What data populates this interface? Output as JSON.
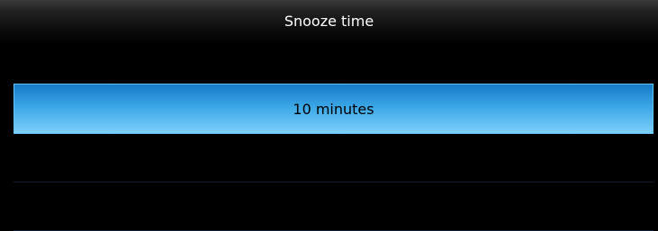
{
  "dialog": {
    "title": "Snooze time"
  },
  "options": [
    {
      "label": "10 minutes",
      "selected": true
    }
  ],
  "colors": {
    "background": "#000000",
    "title_text": "#ffffff",
    "selection_top": "#1579c4",
    "selection_bottom": "#7fd1fb",
    "divider": "#101d33"
  }
}
